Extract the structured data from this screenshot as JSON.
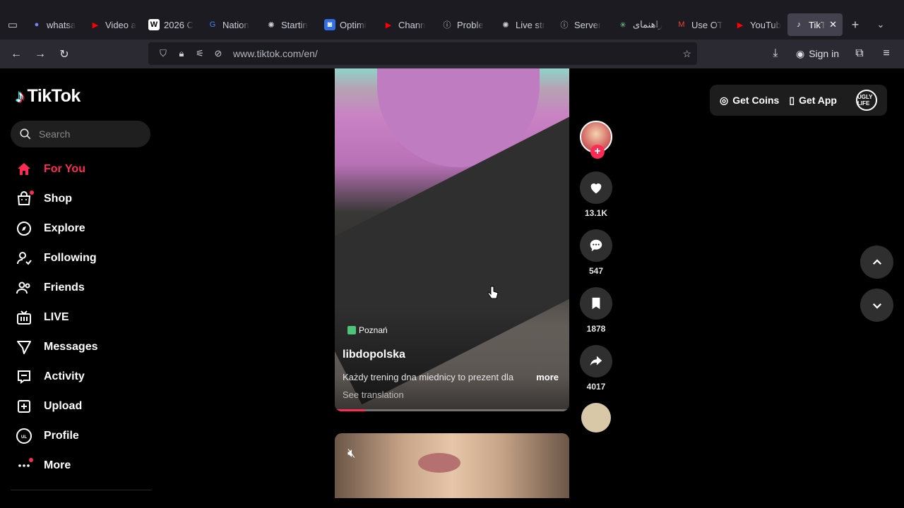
{
  "browser": {
    "tabs": [
      {
        "title": "whatsa",
        "favicon": "whatsapp-icon",
        "color": "#7f7fff"
      },
      {
        "title": "Video a",
        "favicon": "youtube-icon",
        "color": "#ff0000"
      },
      {
        "title": "2026 C",
        "favicon": "wikipedia-icon",
        "color": "#ffffff"
      },
      {
        "title": "Nation",
        "favicon": "google-icon",
        "color": "#4285f4"
      },
      {
        "title": "Startin",
        "favicon": "openai-icon",
        "color": "#cfcfd8"
      },
      {
        "title": "Optimi",
        "favicon": "app-icon",
        "color": "#2f6fe0"
      },
      {
        "title": "Chann",
        "favicon": "youtube-icon",
        "color": "#ff0000"
      },
      {
        "title": "Proble",
        "favicon": "info-icon",
        "color": "#cfcfd8"
      },
      {
        "title": "Live str",
        "favicon": "openai-icon",
        "color": "#cfcfd8"
      },
      {
        "title": "Server",
        "favicon": "info-icon",
        "color": "#cfcfd8"
      },
      {
        "title": "راهنمای",
        "favicon": "sparkle-icon",
        "color": "#7bd88f"
      },
      {
        "title": "Use OT",
        "favicon": "gmail-icon",
        "color": "#ea4335"
      },
      {
        "title": "YouTub",
        "favicon": "youtube-icon",
        "color": "#ff0000"
      },
      {
        "title": "TikTo",
        "favicon": "tiktok-icon",
        "color": "#ffffff"
      }
    ],
    "url": "www.tiktok.com/en/",
    "signin_label": "Sign in"
  },
  "tiktok": {
    "logo_text": "TikTok",
    "search_placeholder": "Search",
    "menu": [
      {
        "label": "For You",
        "icon": "home-icon",
        "active": true
      },
      {
        "label": "Shop",
        "icon": "shop-icon",
        "badge": true
      },
      {
        "label": "Explore",
        "icon": "compass-icon"
      },
      {
        "label": "Following",
        "icon": "following-icon"
      },
      {
        "label": "Friends",
        "icon": "friends-icon"
      },
      {
        "label": "LIVE",
        "icon": "live-icon"
      },
      {
        "label": "Messages",
        "icon": "messages-icon"
      },
      {
        "label": "Activity",
        "icon": "activity-icon"
      },
      {
        "label": "Upload",
        "icon": "upload-icon"
      },
      {
        "label": "Profile",
        "icon": "profile-avatar-icon"
      },
      {
        "label": "More",
        "icon": "more-icon",
        "badge": true
      }
    ],
    "topbar": {
      "get_coins": "Get Coins",
      "get_app": "Get App",
      "profile_badge": "UGLY LIFE"
    },
    "video": {
      "location": "Poznań",
      "author": "libdopolska",
      "caption": "Każdy trening dna miednicy to prezent dla",
      "more": "more",
      "see_translation": "See translation",
      "progress": 0.13
    },
    "actions": {
      "likes": "13.1K",
      "comments": "547",
      "saves": "1878",
      "shares": "4017"
    },
    "accent": "#fe2c55"
  }
}
